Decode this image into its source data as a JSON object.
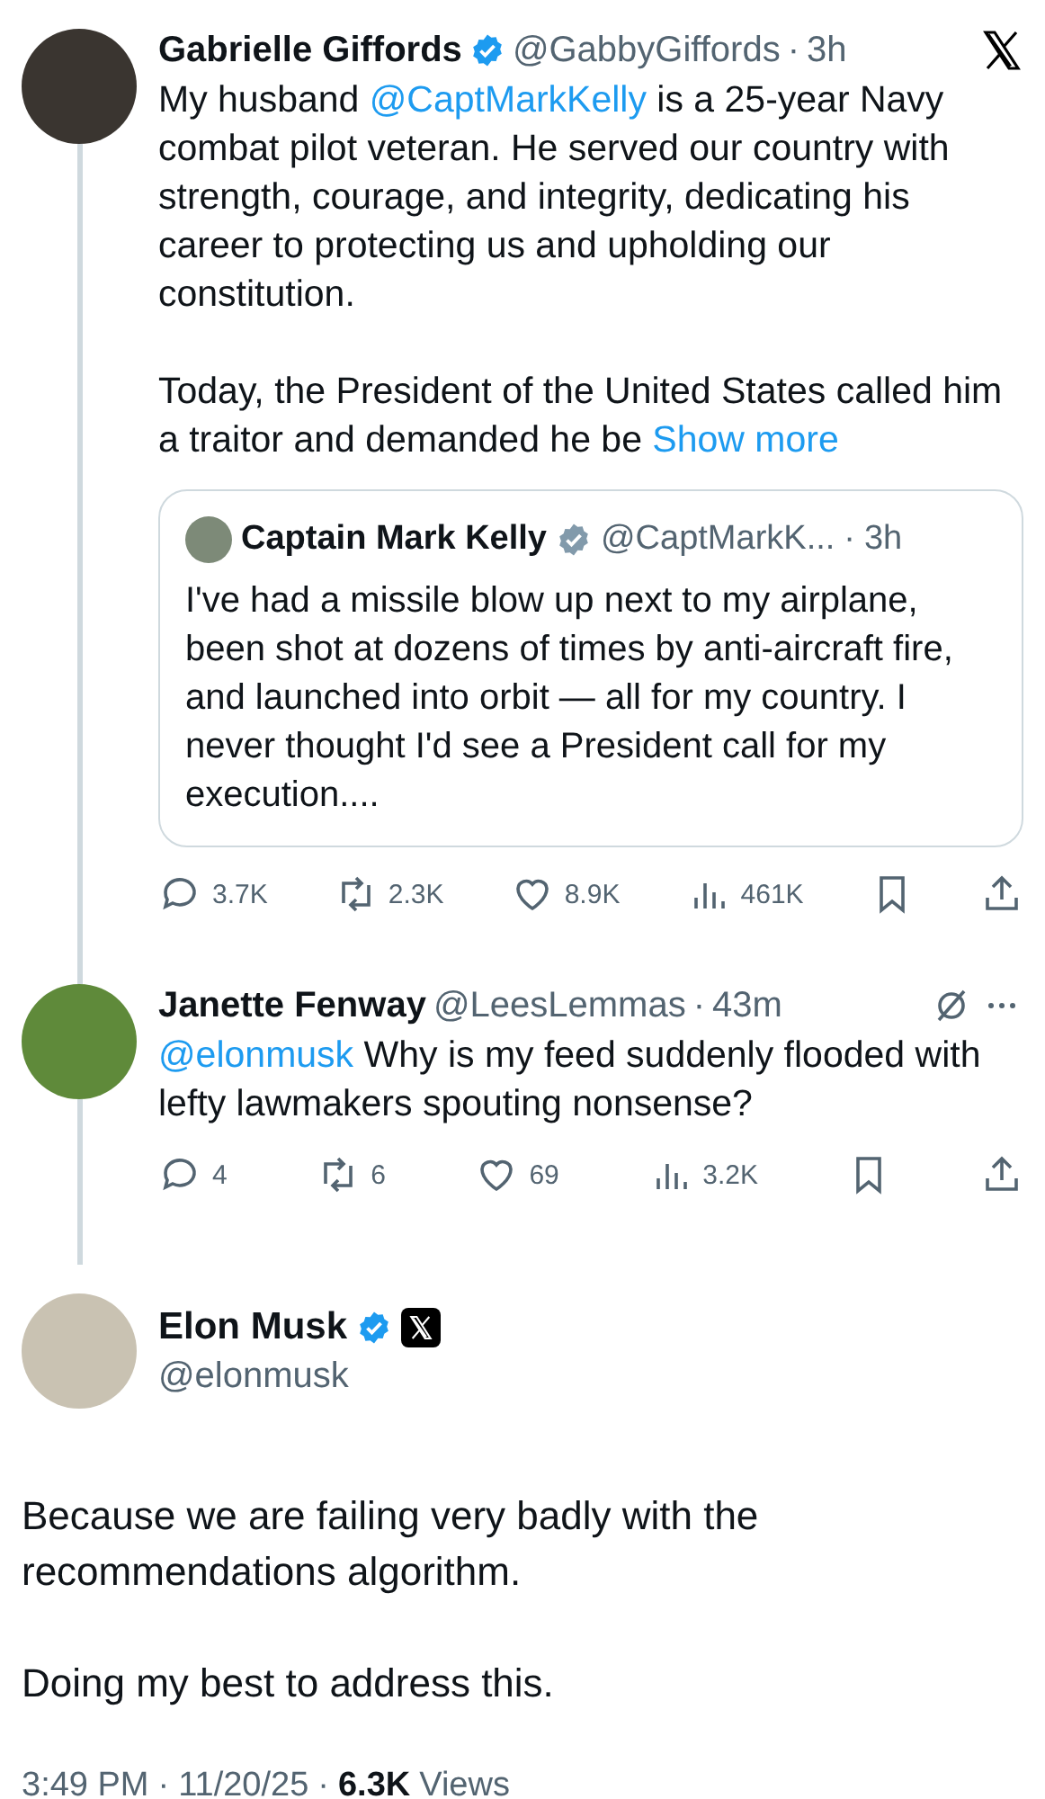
{
  "thread": [
    {
      "author": {
        "name": "Gabrielle Giffords",
        "verified": true,
        "color": "#1d9bf0",
        "handle": "@GabbyGiffords",
        "separator": "·",
        "time": "3h"
      },
      "paragraphs": [
        [
          {
            "kind": "plain",
            "text": "My husband "
          },
          {
            "kind": "mention",
            "text": "@CaptMarkKelly"
          },
          {
            "kind": "plain",
            "text": " is a 25-year Navy combat pilot veteran. He served our country with strength, courage, and integrity, dedicating his career to protecting us and upholding our constitution."
          }
        ],
        [
          {
            "kind": "plain",
            "text": "Today, the President of the United States called him a traitor and demanded he be "
          },
          {
            "kind": "link",
            "text": "Show more"
          }
        ]
      ],
      "quote": {
        "author": {
          "name": "Captain Mark Kelly",
          "verified": true,
          "color": "#829aab",
          "handle": "@CaptMarkK...",
          "separator": "·",
          "time": "3h"
        },
        "text": "I've had a missile blow up next to my airplane, been shot at dozens of times by anti-aircraft fire, and launched into orbit — all for my country. I never thought I'd see a President call for my execution...."
      },
      "actions": {
        "replies": "3.7K",
        "reposts": "2.3K",
        "likes": "8.9K",
        "views": "461K"
      }
    },
    {
      "author": {
        "name": "Janette Fenway",
        "verified": false,
        "handle": "@LeesLemmas",
        "separator": "·",
        "time": "43m"
      },
      "paragraphs": [
        [
          {
            "kind": "mention",
            "text": "@elonmusk"
          },
          {
            "kind": "plain",
            "text": " Why is my feed suddenly flooded with lefty lawmakers spouting nonsense?"
          }
        ]
      ],
      "actions": {
        "replies": "4",
        "reposts": "6",
        "likes": "69",
        "views": "3.2K"
      }
    }
  ],
  "main": {
    "author": {
      "name": "Elon Musk",
      "verified": true,
      "color": "#1d9bf0",
      "handle": "@elonmusk"
    },
    "paragraphs": [
      "Because we are failing very badly with the recommendations algorithm.",
      "Doing my best to address this."
    ],
    "time": "3:49 PM",
    "separator_1": "·",
    "date": "11/20/25",
    "separator_2": "·",
    "views_count": "6.3K",
    "views_label": "Views"
  }
}
